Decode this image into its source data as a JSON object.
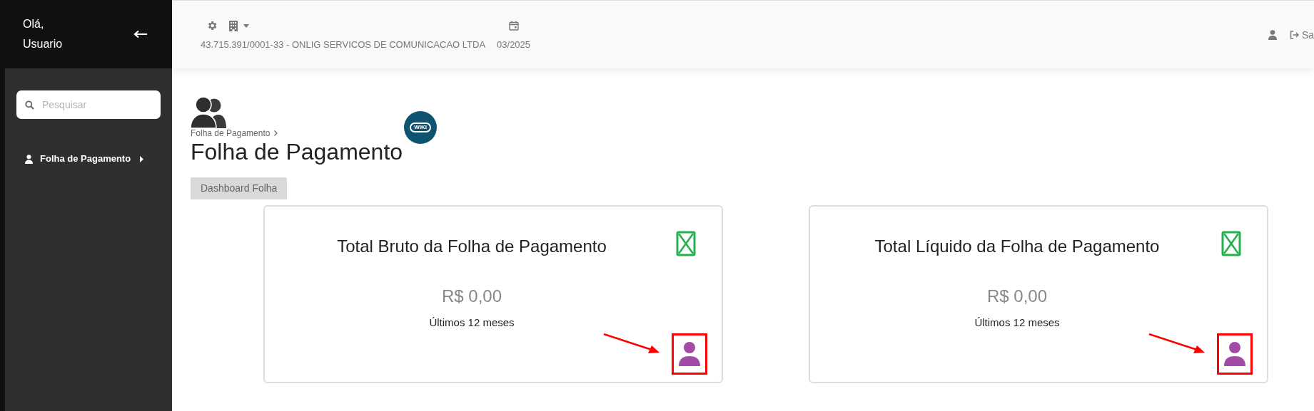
{
  "sidebar": {
    "greeting": "Olá,",
    "user": "Usuario",
    "search": {
      "placeholder": "Pesquisar"
    },
    "items": [
      {
        "label": "Folha de Pagamento"
      }
    ]
  },
  "header": {
    "company": "43.715.391/0001-33 - ONLIG SERVICOS DE COMUNICACAO LTDA",
    "period": "03/2025",
    "logout": "Sa"
  },
  "page": {
    "breadcrumb": [
      "Folha de Pagamento"
    ],
    "title": "Folha de Pagamento",
    "wiki": "WIKI",
    "tabs": [
      {
        "label": "Dashboard Folha",
        "selected": true
      }
    ]
  },
  "cards": [
    {
      "title": "Total Bruto da Folha de Pagamento",
      "value": "R$ 0,00",
      "caption": "Últimos 12 meses",
      "highlighted": true
    },
    {
      "title": "Total Líquido da Folha de Pagamento",
      "value": "R$ 0,00",
      "caption": "Últimos 12 meses",
      "highlighted": true
    }
  ]
}
